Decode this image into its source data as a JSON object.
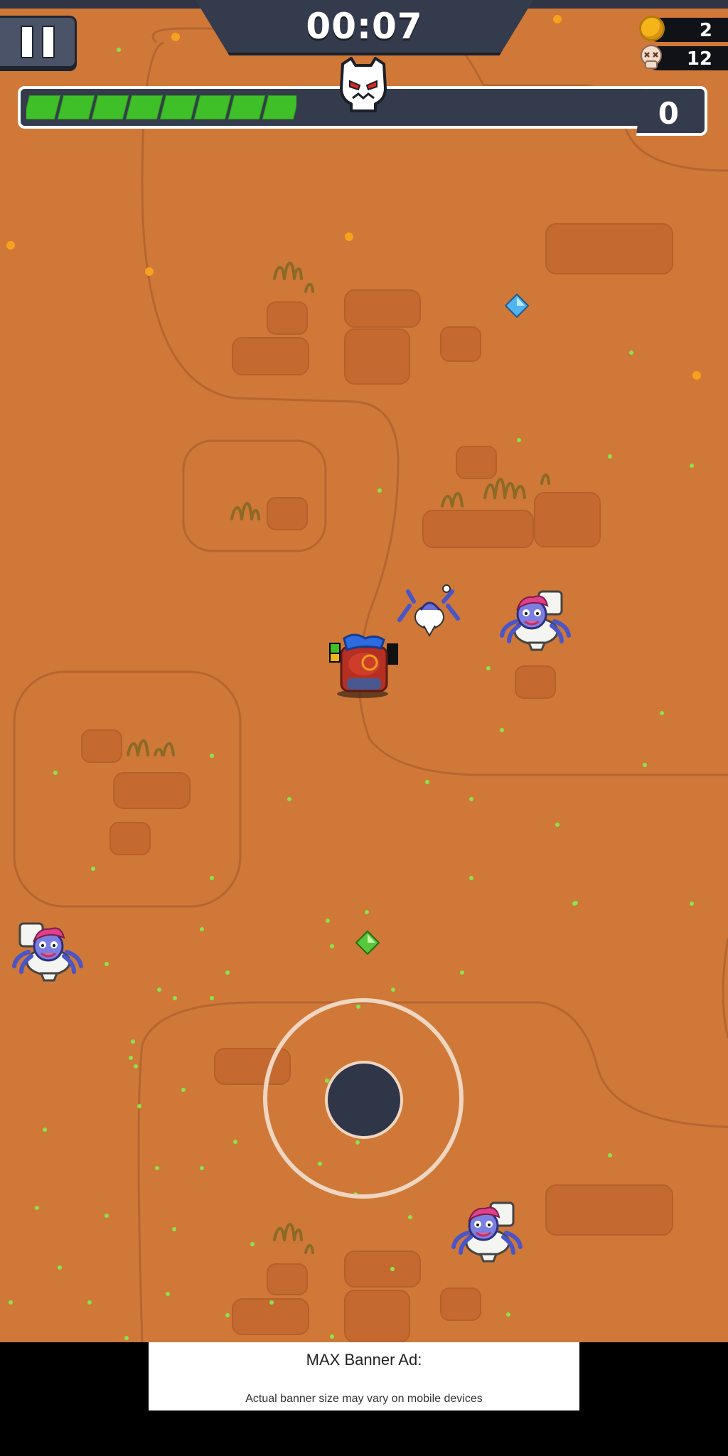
{
  "hud": {
    "timer": "00:07",
    "coins": "2",
    "skulls": "12",
    "kill_count": "0",
    "wave_progress_fraction": 0.47,
    "pause_icon": "pause-icon",
    "coin_icon": "coin-icon",
    "skull_icon": "skull-icon",
    "boss_icon": "boss-skull-icon"
  },
  "ad": {
    "title": "MAX Banner Ad:",
    "subtitle": "Actual banner size may vary on mobile devices"
  },
  "colors": {
    "ground": "#cf7838",
    "panel": "#343b4c",
    "progress_green": "#3fbf28",
    "coin": "#f4b41a"
  },
  "entities": {
    "enemies": [
      "toilet-spider-enemy",
      "toilet-spider-enemy",
      "toilet-spider-enemy",
      "toilet-spider-enemy"
    ],
    "pickups": [
      "blue-gem",
      "green-gem"
    ],
    "player": "player-character"
  }
}
